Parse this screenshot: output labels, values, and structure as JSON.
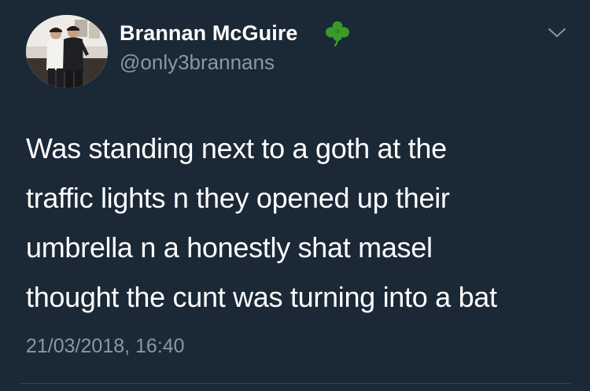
{
  "user": {
    "display_name": "Brannan McGuire",
    "handle": "@only3brannans",
    "badge_icon": "shamrock-icon",
    "avatar_icon": "profile-photo"
  },
  "tweet": {
    "lines": [
      "Was standing next to a goth at the",
      "traffic lights n they opened up their",
      "umbrella n a honestly shat masel",
      "thought the cunt was turning into a bat"
    ],
    "timestamp": "21/03/2018, 16:40"
  },
  "controls": {
    "menu_icon": "chevron-down-icon"
  },
  "colors": {
    "background": "#1b2836",
    "primary_text": "#ffffff",
    "secondary_text": "#8899a6",
    "divider": "#38444d",
    "badge_green": "#3a9a2a"
  }
}
